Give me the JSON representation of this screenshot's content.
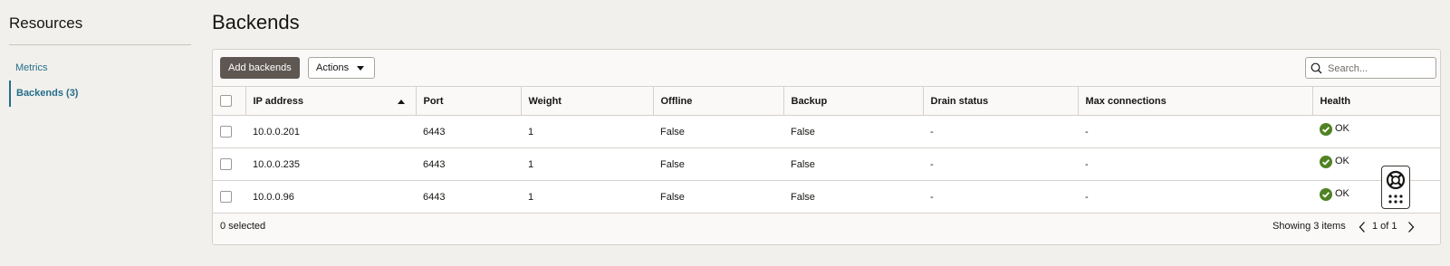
{
  "sidebar": {
    "title": "Resources",
    "items": [
      {
        "label": "Metrics"
      },
      {
        "label": "Backends (3)"
      }
    ]
  },
  "page": {
    "title": "Backends"
  },
  "toolbar": {
    "add_label": "Add backends",
    "actions_label": "Actions",
    "search_placeholder": "Search..."
  },
  "table": {
    "columns": [
      "IP address",
      "Port",
      "Weight",
      "Offline",
      "Backup",
      "Drain status",
      "Max connections",
      "Health"
    ],
    "sorted_column": "IP address",
    "sort_direction": "ascending",
    "rows": [
      {
        "ip": "10.0.0.201",
        "port": "6443",
        "weight": "1",
        "offline": "False",
        "backup": "False",
        "drain": "-",
        "max_conn": "-",
        "health": "OK"
      },
      {
        "ip": "10.0.0.235",
        "port": "6443",
        "weight": "1",
        "offline": "False",
        "backup": "False",
        "drain": "-",
        "max_conn": "-",
        "health": "OK"
      },
      {
        "ip": "10.0.0.96",
        "port": "6443",
        "weight": "1",
        "offline": "False",
        "backup": "False",
        "drain": "-",
        "max_conn": "-",
        "health": "OK"
      }
    ]
  },
  "footer": {
    "selected": "0 selected",
    "showing": "Showing 3 items",
    "page": "1 of 1"
  },
  "icons": {
    "health": "check-circle-icon",
    "help": "lifebuoy-icon",
    "apps": "grid-dots-icon"
  },
  "colors": {
    "accent": "#246e8b",
    "ok": "#508223",
    "primary_button": "#5f5852"
  }
}
